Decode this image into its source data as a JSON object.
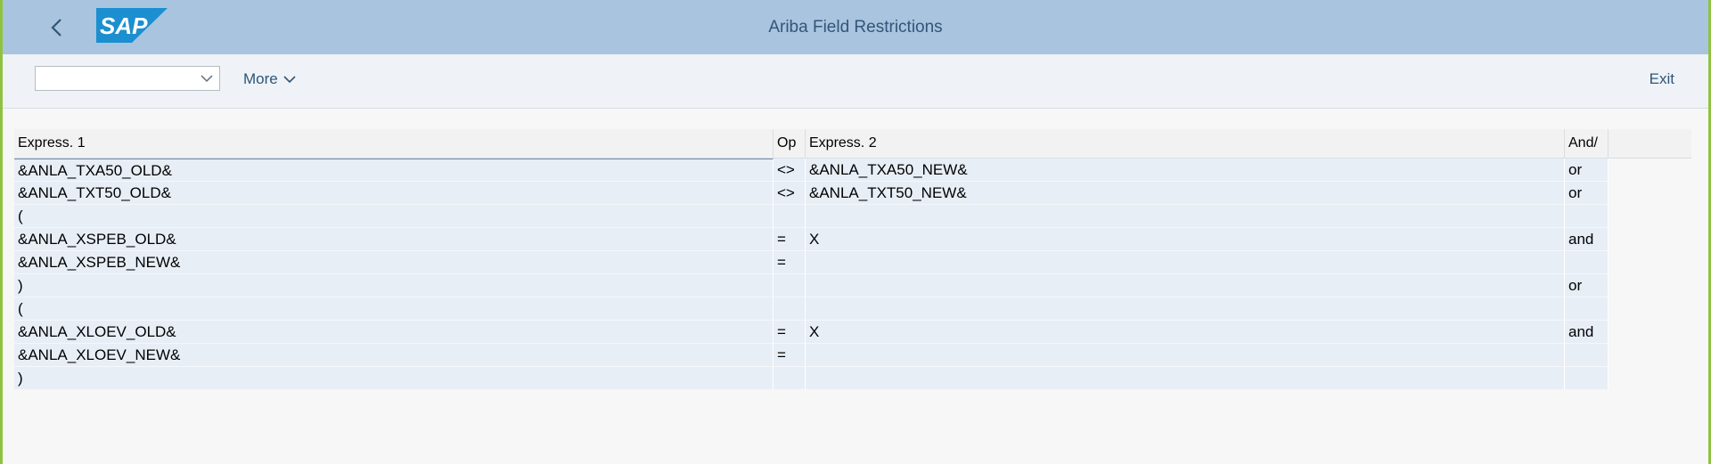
{
  "window": {
    "title": "Ariba Field Restrictions"
  },
  "header": {
    "back_icon": "chevron-left-icon",
    "logo_text": "SAP",
    "colors": {
      "shell_bg": "#a9c4de",
      "title": "#32557a",
      "logo_blue": "#1b8fd0"
    }
  },
  "toolbar": {
    "select_value": "",
    "more_label": "More",
    "exit_label": "Exit"
  },
  "table": {
    "columns": [
      "Express. 1",
      "Op",
      "Express. 2",
      "And/"
    ],
    "rows": [
      {
        "expr1": "&ANLA_TXA50_OLD&",
        "op": "<>",
        "expr2": "&ANLA_TXA50_NEW&",
        "andor": "or"
      },
      {
        "expr1": "&ANLA_TXT50_OLD&",
        "op": "<>",
        "expr2": "&ANLA_TXT50_NEW&",
        "andor": "or"
      },
      {
        "expr1": "(",
        "op": "",
        "expr2": "",
        "andor": ""
      },
      {
        "expr1": "&ANLA_XSPEB_OLD&",
        "op": "=",
        "expr2": "X",
        "andor": "and"
      },
      {
        "expr1": "&ANLA_XSPEB_NEW&",
        "op": "=",
        "expr2": "",
        "andor": ""
      },
      {
        "expr1": ")",
        "op": "",
        "expr2": "",
        "andor": "or"
      },
      {
        "expr1": "(",
        "op": "",
        "expr2": "",
        "andor": ""
      },
      {
        "expr1": "&ANLA_XLOEV_OLD&",
        "op": "=",
        "expr2": "X",
        "andor": "and"
      },
      {
        "expr1": "&ANLA_XLOEV_NEW&",
        "op": "=",
        "expr2": "",
        "andor": ""
      },
      {
        "expr1": ")",
        "op": "",
        "expr2": "",
        "andor": ""
      }
    ]
  }
}
